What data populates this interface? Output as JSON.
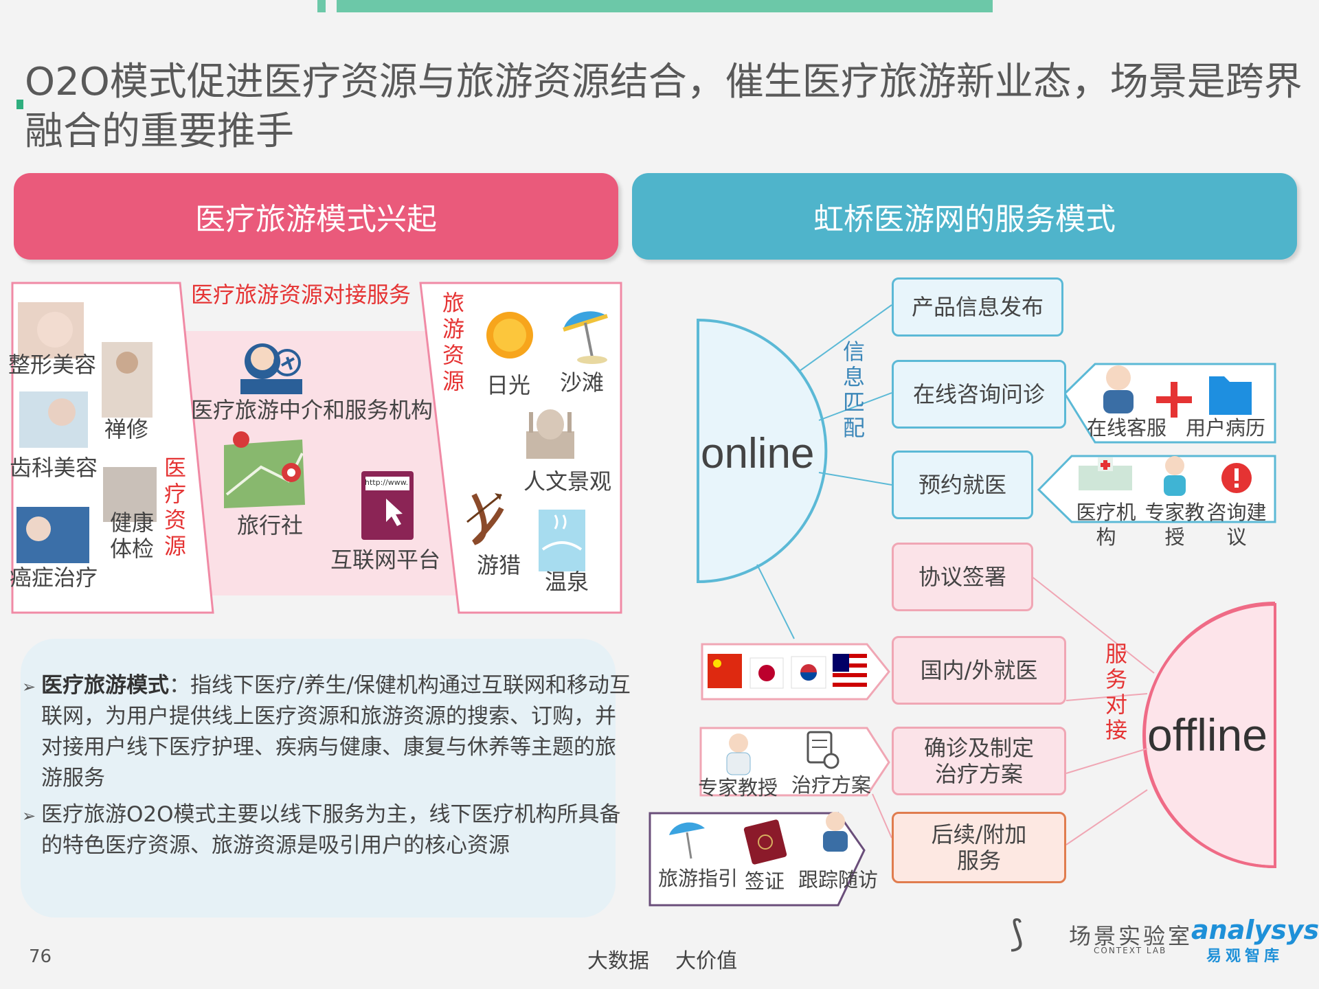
{
  "title": "O2O模式促进医疗资源与旅游资源结合，催生医疗旅游新业态，场景是跨界融合的重要推手",
  "left_header": "医疗旅游模式兴起",
  "right_header": "虹桥医游网的服务模式",
  "left": {
    "connect_label": "医疗旅游资源对接服务",
    "medical_items": [
      "整形美容",
      "禅修",
      "齿科美容",
      "健康\n体检",
      "癌症治疗"
    ],
    "medical_label": "医疗资源",
    "middle_items": [
      "医疗旅游中介和服务机构",
      "旅行社",
      "互联网平台"
    ],
    "url_text": "http://www.",
    "travel_label": "旅游资源",
    "travel_items": [
      "日光",
      "沙滩",
      "人文景观",
      "游猎",
      "温泉"
    ]
  },
  "bullets": [
    {
      "bold": "医疗旅游模式",
      "text": "：指线下医疗/养生/保健机构通过互联网和移动互联网，为用户提供线上医疗资源和旅游资源的搜索、订购，并对接用户线下医疗护理、疾病与健康、康复与休养等主题的旅游服务"
    },
    {
      "bold": "",
      "text": "医疗旅游O2O模式主要以线下服务为主，线下医疗机构所具备的特色医疗资源、旅游资源是吸引用户的核心资源"
    }
  ],
  "right": {
    "online": "online",
    "offline": "offline",
    "info_match": "信息匹配",
    "service_connect": "服务对接",
    "online_boxes": [
      "产品信息发布",
      "在线咨询问诊",
      "预约就医"
    ],
    "offline_boxes": [
      "协议签署",
      "国内/外就医",
      "确诊及制定\n治疗方案",
      "后续/附加\n服务"
    ],
    "consult_details": [
      "在线客服",
      "用户病历"
    ],
    "booking_details": [
      "医疗机\n构",
      "专家教\n授",
      "咨询建\n议"
    ],
    "treatment_details": [
      "专家教授",
      "治疗方案"
    ],
    "followup_details": [
      "旅游指引",
      "签证",
      "跟踪随访"
    ]
  },
  "footer": {
    "page_number": "76",
    "slogan": "大数据    大价值",
    "logo_cn": "场景实验室",
    "logo_en": "CONTEXT LAB",
    "brand": "analysys",
    "brand_cn": "易观智库"
  },
  "colors": {
    "pink": "#ea5a7b",
    "teal": "#4fb4cb",
    "green": "#6cc8a8",
    "red_text": "#e53333"
  }
}
